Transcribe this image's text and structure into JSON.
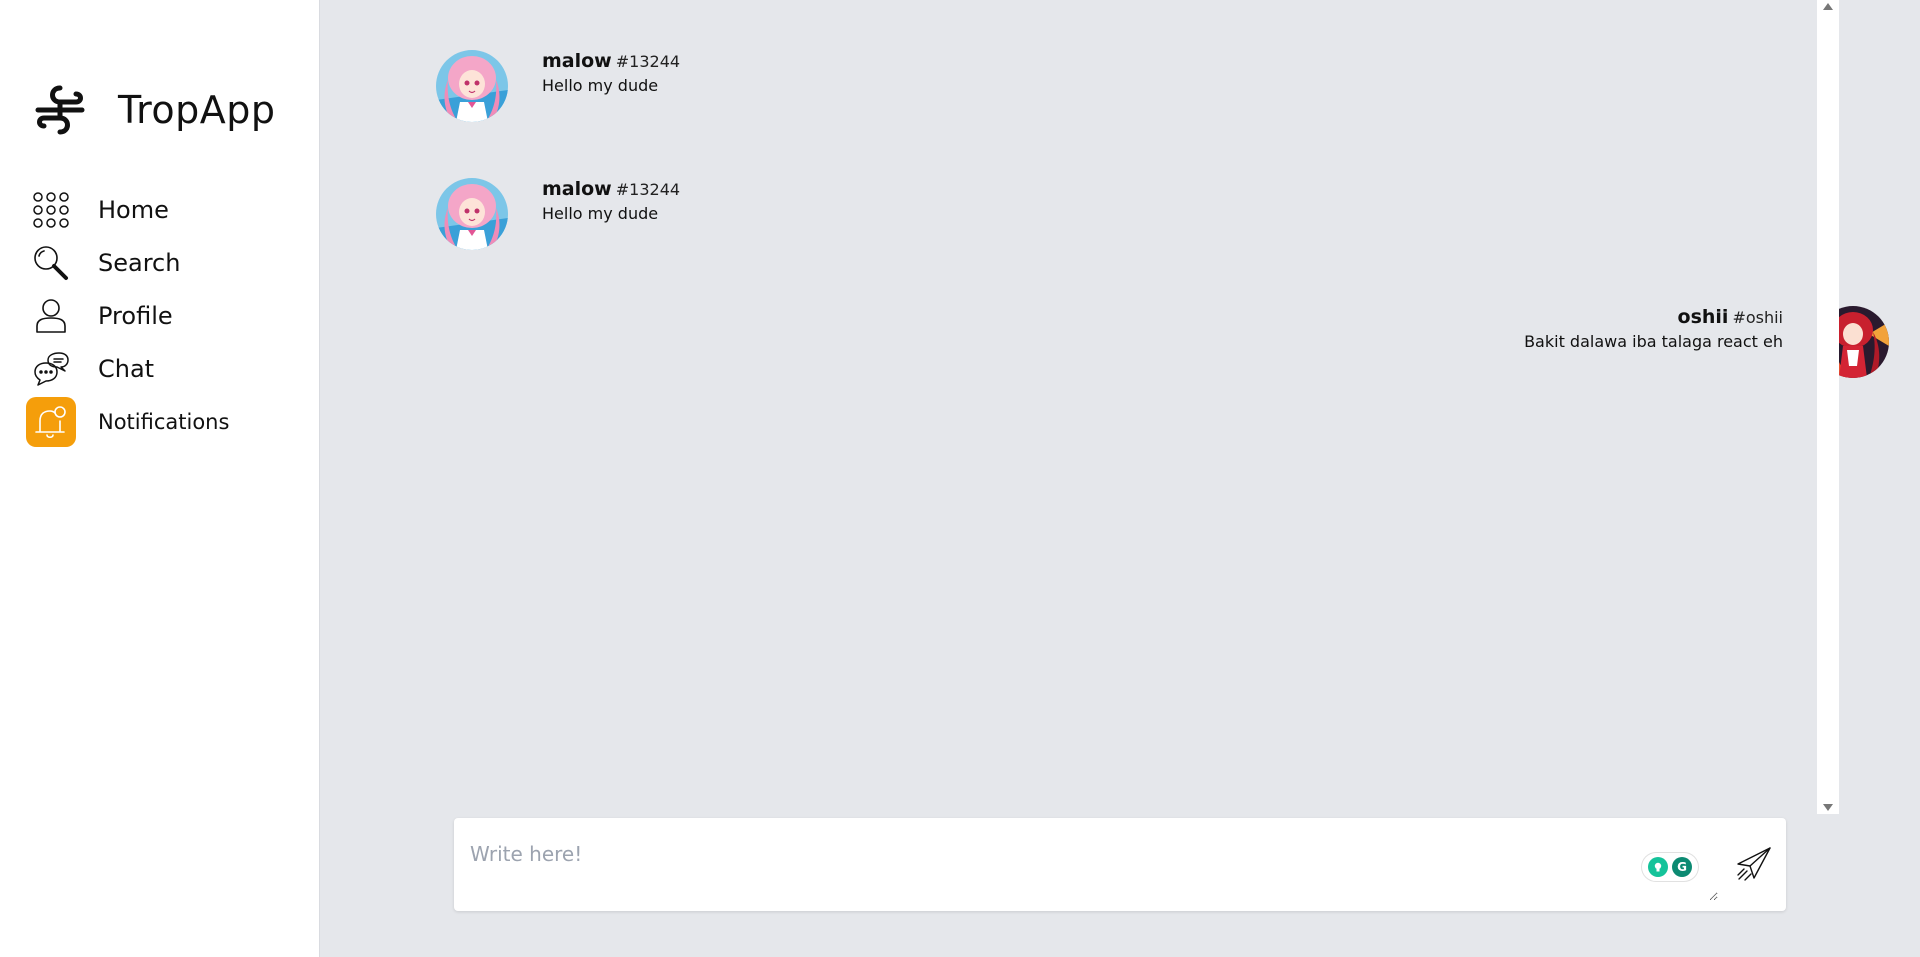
{
  "app": {
    "name": "TropApp"
  },
  "sidebar": {
    "items": [
      {
        "label": "Home",
        "icon": "grid-dots-icon"
      },
      {
        "label": "Search",
        "icon": "search-icon"
      },
      {
        "label": "Profile",
        "icon": "user-icon"
      },
      {
        "label": "Chat",
        "icon": "chat-bubbles-icon"
      },
      {
        "label": "Notifications",
        "icon": "bell-icon",
        "active": true
      }
    ]
  },
  "messages": [
    {
      "username": "malow",
      "tag": "#13244",
      "text": "Hello my dude",
      "side": "left"
    },
    {
      "username": "malow",
      "tag": "#13244",
      "text": "Hello my dude",
      "side": "left"
    },
    {
      "username": "oshii",
      "tag": "#oshii",
      "text": "Bakit dalawa iba talaga react eh",
      "side": "right"
    }
  ],
  "composer": {
    "placeholder": "Write here!"
  },
  "colors": {
    "accent": "#f59e0b",
    "main_bg": "#e5e7eb",
    "sidebar_bg": "#ffffff"
  }
}
